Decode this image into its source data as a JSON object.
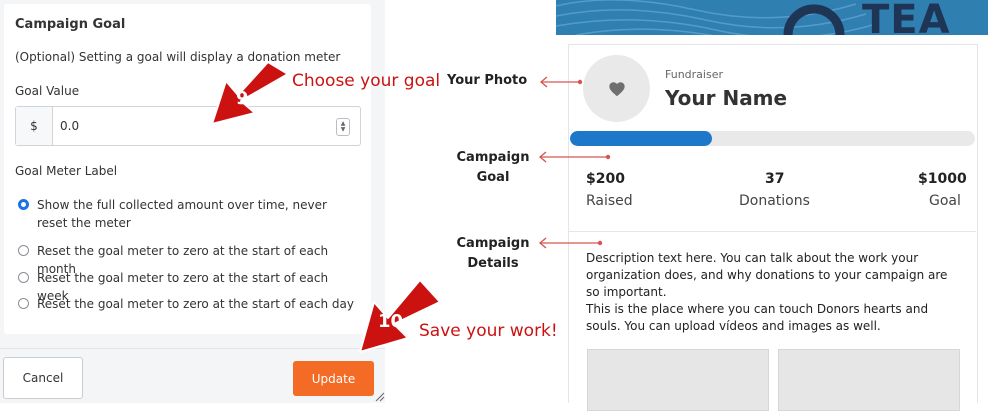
{
  "settings": {
    "title": "Campaign Goal",
    "hint": "(Optional) Setting a goal will display a donation meter",
    "goal_label": "Goal Value",
    "currency_symbol": "$",
    "goal_value": "0.0",
    "meter_label": "Goal Meter Label",
    "options": [
      {
        "label": "Show the full collected amount over time, never reset the meter",
        "selected": true
      },
      {
        "label": "Reset the goal meter to zero at the start of each month",
        "selected": false
      },
      {
        "label": "Reset the goal meter to zero at the start of each week",
        "selected": false
      },
      {
        "label": "Reset the goal meter to zero at the start of each day",
        "selected": false
      }
    ],
    "cancel_label": "Cancel",
    "update_label": "Update",
    "accent": "#f36b24",
    "radio_accent": "#1a73e8"
  },
  "annotations": {
    "step9_number": "9",
    "step9_text": "Choose your goal",
    "step10_number": "10",
    "step10_text": "Save your work!",
    "your_photo": "Your Photo",
    "campaign_goal_line1": "Campaign",
    "campaign_goal_line2": "Goal",
    "campaign_details_line1": "Campaign",
    "campaign_details_line2": "Details",
    "color": "#cc1111"
  },
  "preview": {
    "banner_text": "TEA",
    "fundraiser_label": "Fundraiser",
    "fundraiser_name": "Your Name",
    "progress_fraction": 0.35,
    "raised_value": "$200",
    "raised_label": "Raised",
    "donations_value": "37",
    "donations_label": "Donations",
    "goal_value": "$1000",
    "goal_label": "Goal",
    "description": [
      "Description text here. You can talk about the work your organization does, and why donations to your campaign are so important.",
      "This is the place where you can touch Donors hearts and souls. You can upload vídeos and images as well."
    ],
    "progress_color": "#1d78c9",
    "banner_color": "#2f7fb1"
  }
}
